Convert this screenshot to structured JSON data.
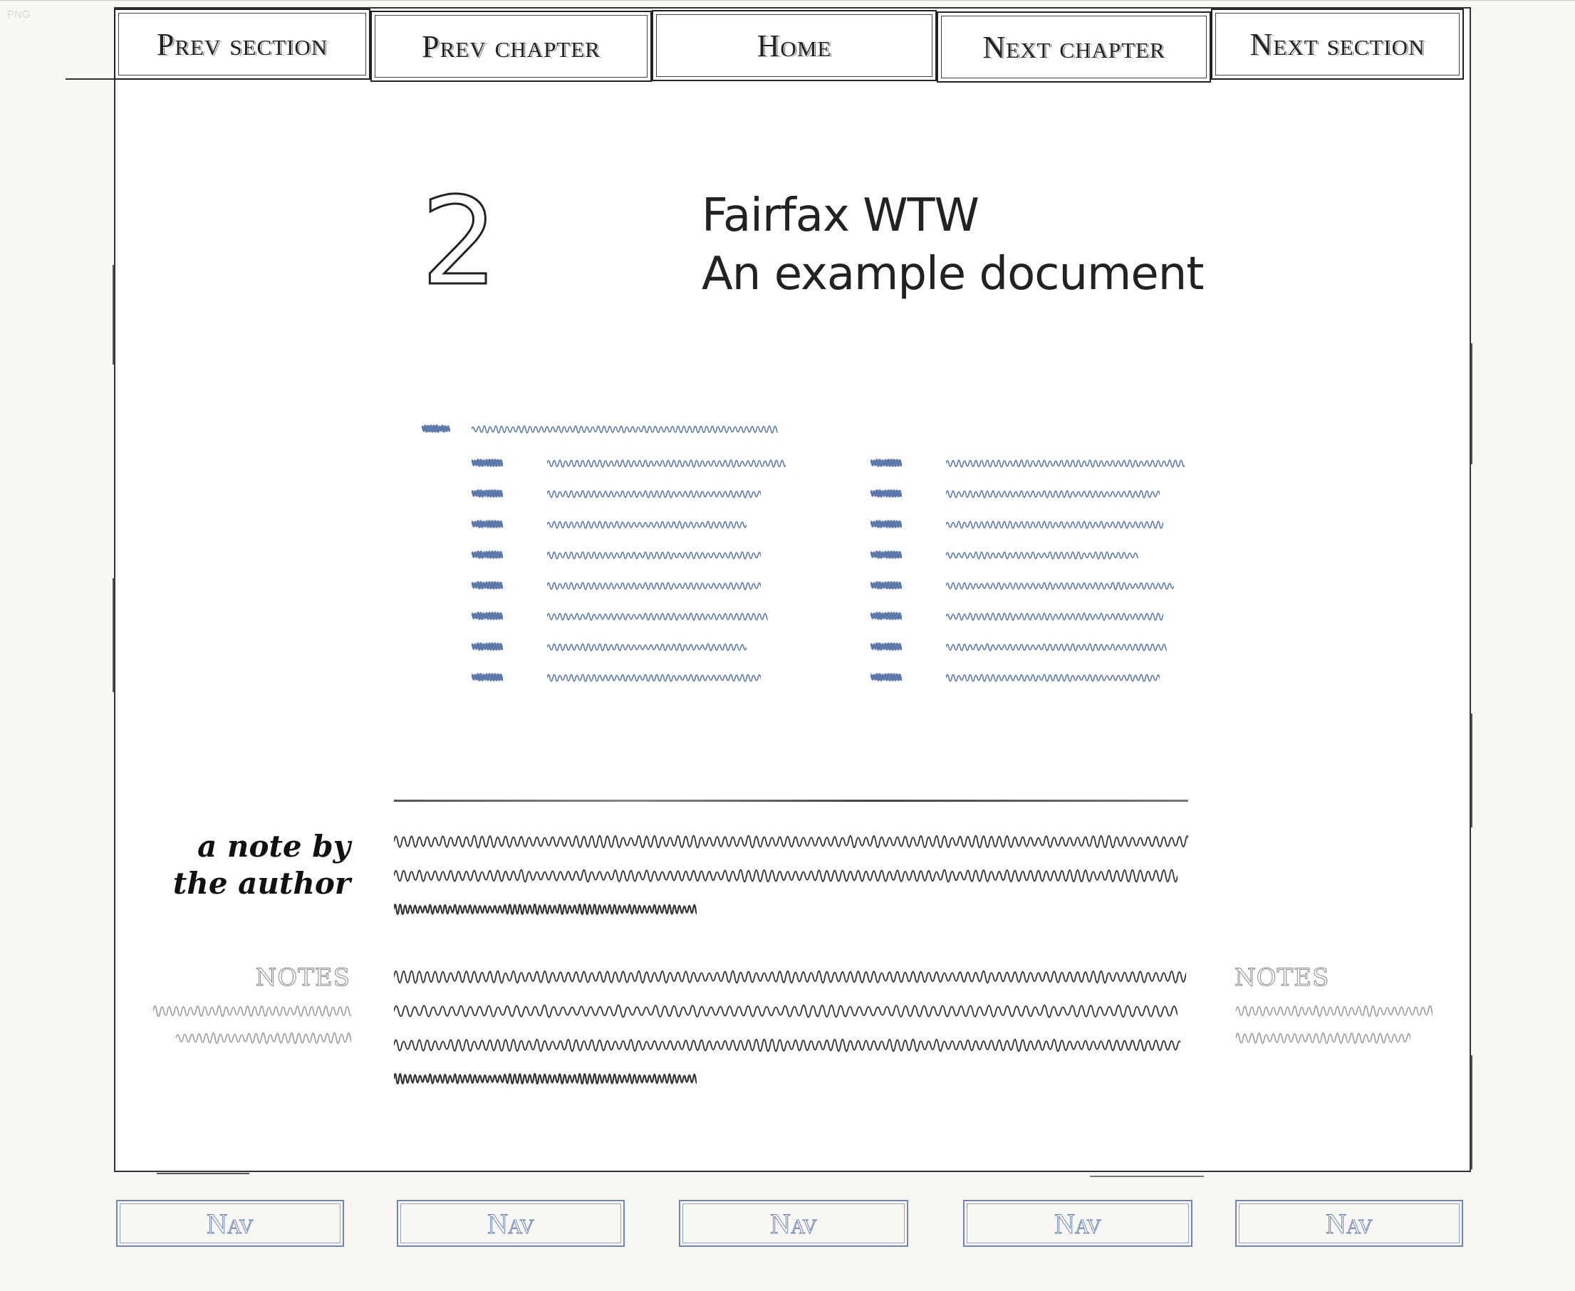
{
  "watermark": "PNG",
  "top_tabs": {
    "prev_section": "Prev section",
    "prev_chapter": "Prev chapter",
    "home": "Home",
    "next_chapter": "Next chapter",
    "next_section": "Next section"
  },
  "chapter": {
    "number": "2",
    "title_line1": "Fairfax WTW",
    "title_line2": "An example document"
  },
  "toc": {
    "accent_color": "#5d79ab",
    "heading_rows": 1,
    "left_column_rows": 8,
    "right_column_rows": 8
  },
  "author_note": {
    "label": "a note by the author"
  },
  "notes": {
    "left_label": "NOTES",
    "right_label": "NOTES"
  },
  "bottom_nav": {
    "labels": [
      "Nav",
      "Nav",
      "Nav",
      "Nav",
      "Nav"
    ],
    "color": "#6d86b5"
  },
  "colors": {
    "ink": "#222222",
    "greeked_text": "#333333",
    "muted_notes": "#999999",
    "page_bg": "#f8f7f4",
    "frame_bg": "#ffffff"
  }
}
